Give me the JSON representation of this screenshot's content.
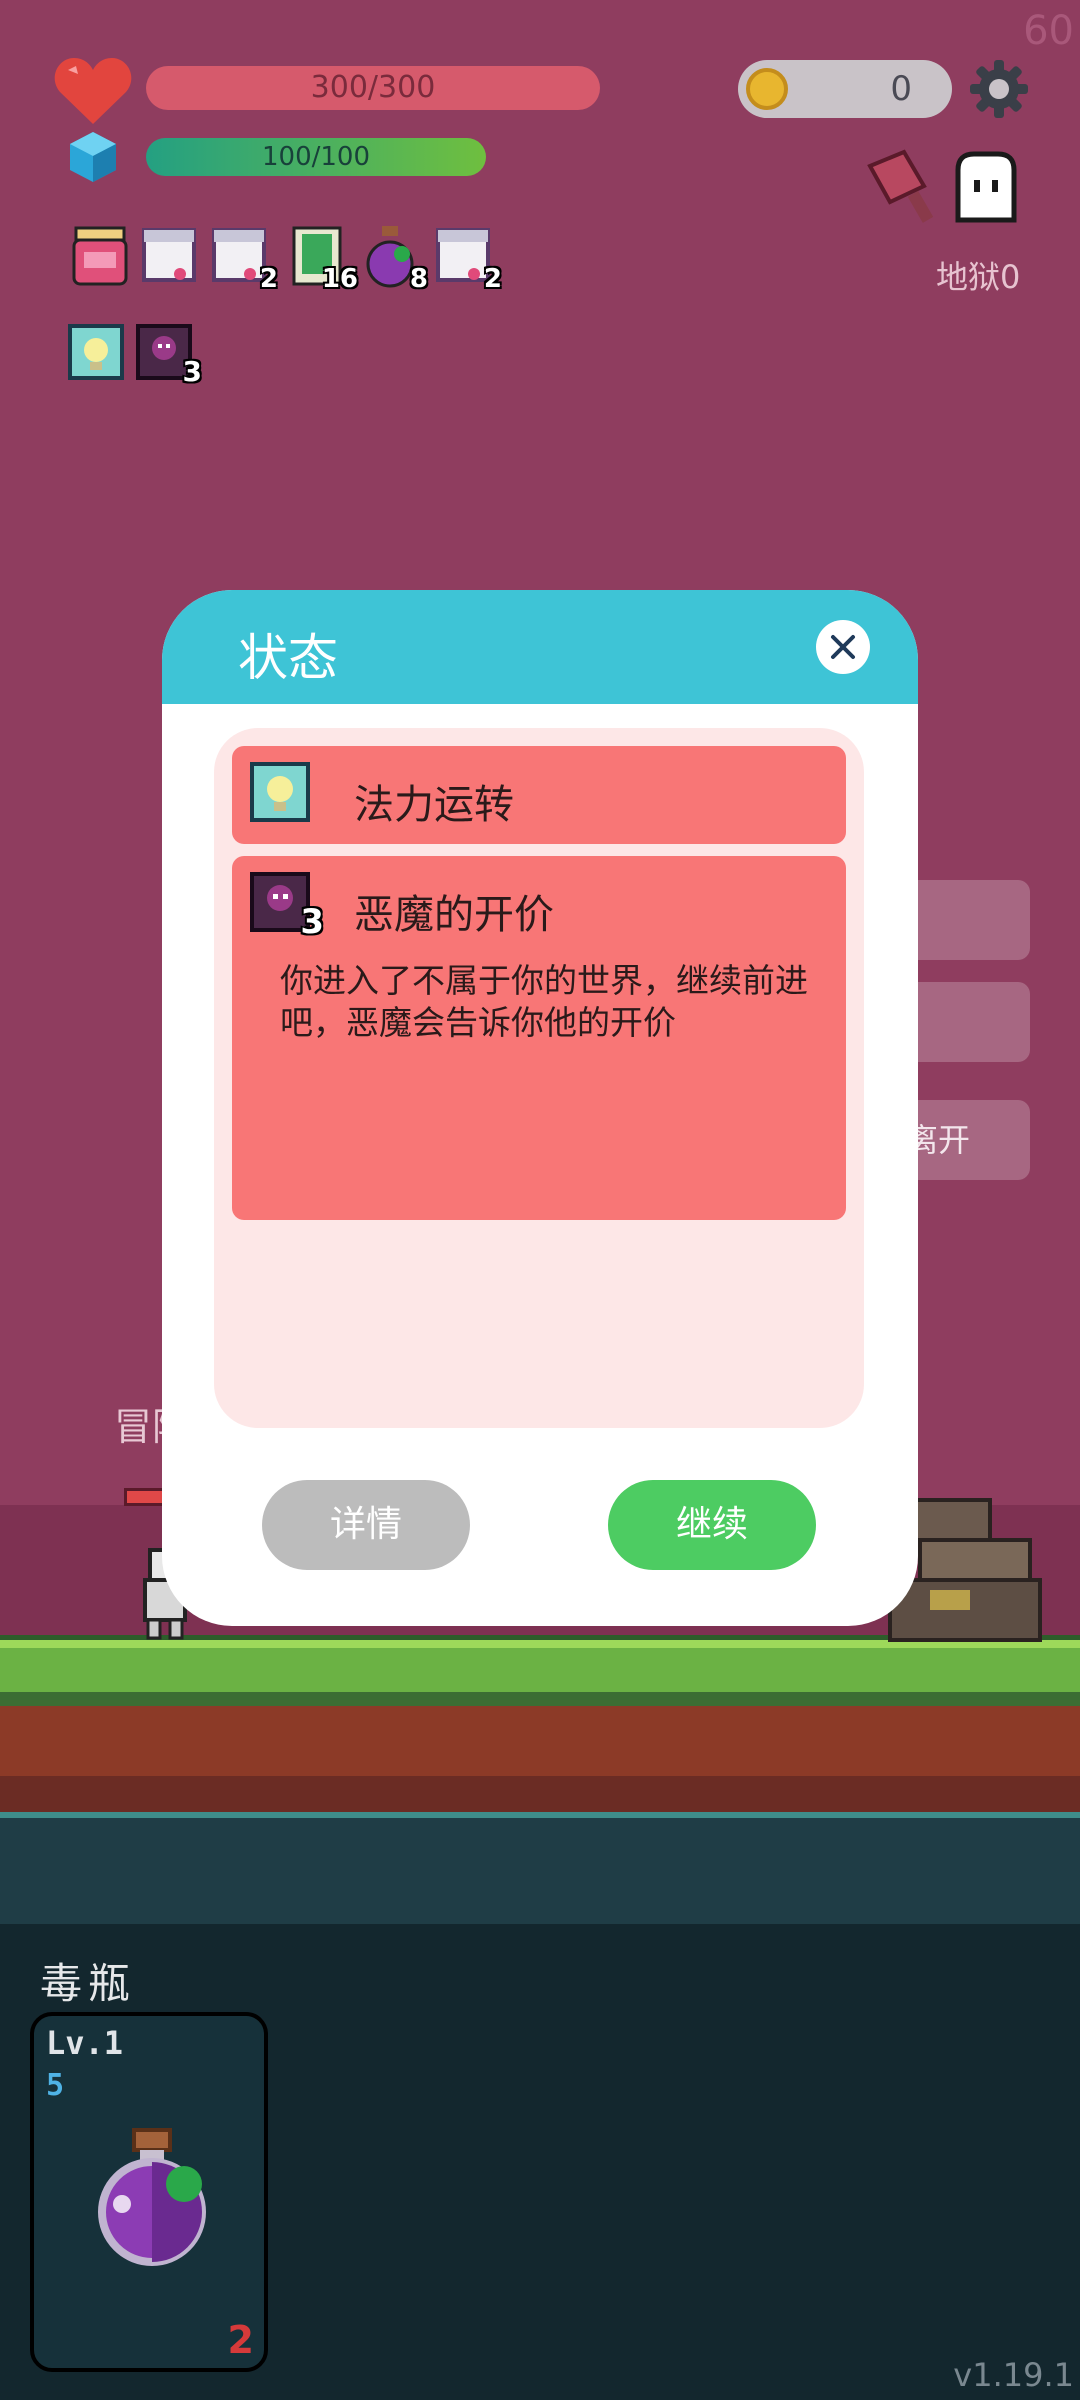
{
  "fps": "60",
  "hud": {
    "hp_text": "300/300",
    "mp_text": "100/100",
    "coins": "0",
    "hell_label": "地狱0",
    "items": [
      {
        "name": "jam-jar-icon",
        "count": ""
      },
      {
        "name": "scroll-icon",
        "count": ""
      },
      {
        "name": "scroll-icon",
        "count": "2"
      },
      {
        "name": "green-book-icon",
        "count": "16"
      },
      {
        "name": "poison-bottle-icon",
        "count": "8"
      },
      {
        "name": "scroll-icon",
        "count": "2"
      }
    ],
    "statuses": [
      {
        "name": "mana-flow-icon",
        "count": ""
      },
      {
        "name": "demon-price-icon",
        "count": "3"
      }
    ]
  },
  "background": {
    "adventurer_label": "冒险",
    "side_button_3": "离开"
  },
  "modal": {
    "title": "状态",
    "entries": [
      {
        "icon": "mana-flow-icon",
        "name": "法力运转",
        "count": "",
        "desc": ""
      },
      {
        "icon": "demon-price-icon",
        "name": "恶魔的开价",
        "count": "3",
        "desc": "你进入了不属于你的世界，继续前进吧，恶魔会告诉你他的开价"
      }
    ],
    "detail_button": "详情",
    "continue_button": "继续"
  },
  "bag": {
    "title": "毒瓶",
    "card": {
      "level": "Lv.1",
      "cost": "5",
      "count": "2"
    }
  },
  "version": "v1.19.1",
  "colors": {
    "sky": "#8f3d5f",
    "modal_header": "#3ec4d6",
    "entry_bg": "#f87676",
    "continue": "#4dcc62",
    "detail": "#bcbcbc"
  }
}
